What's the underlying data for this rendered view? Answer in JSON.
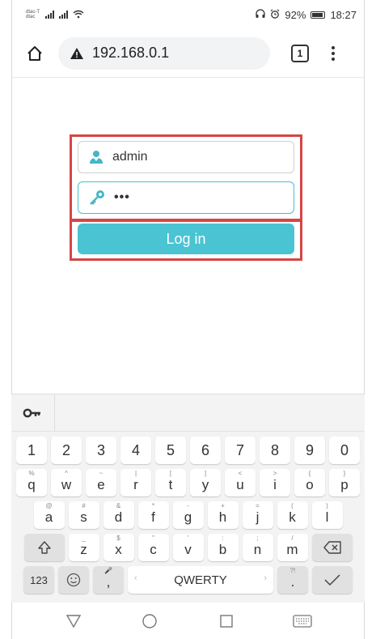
{
  "status_bar": {
    "carrier_top": "dtac-T",
    "carrier_bottom": "dtac",
    "battery_text": "92%",
    "time": "18:27"
  },
  "browser": {
    "url": "192.168.0.1",
    "tab_count": "1"
  },
  "login_form": {
    "username_value": "admin",
    "password_value": "•••",
    "login_label": "Log in",
    "accent_color": "#4ac3d3",
    "highlight_color": "#d64545"
  },
  "keyboard": {
    "number_row": [
      "1",
      "2",
      "3",
      "4",
      "5",
      "6",
      "7",
      "8",
      "9",
      "0"
    ],
    "row1": [
      {
        "hint": "%",
        "key": "q"
      },
      {
        "hint": "^",
        "key": "w"
      },
      {
        "hint": "~",
        "key": "e"
      },
      {
        "hint": "|",
        "key": "r"
      },
      {
        "hint": "[",
        "key": "t"
      },
      {
        "hint": "]",
        "key": "y"
      },
      {
        "hint": "<",
        "key": "u"
      },
      {
        "hint": ">",
        "key": "i"
      },
      {
        "hint": "{",
        "key": "o"
      },
      {
        "hint": "}",
        "key": "p"
      }
    ],
    "row2": [
      {
        "hint": "@",
        "key": "a"
      },
      {
        "hint": "#",
        "key": "s"
      },
      {
        "hint": "&",
        "key": "d"
      },
      {
        "hint": "*",
        "key": "f"
      },
      {
        "hint": "-",
        "key": "g"
      },
      {
        "hint": "+",
        "key": "h"
      },
      {
        "hint": "=",
        "key": "j"
      },
      {
        "hint": "(",
        "key": "k"
      },
      {
        "hint": ")",
        "key": "l"
      }
    ],
    "row3": [
      {
        "hint": "_",
        "key": "z"
      },
      {
        "hint": "$",
        "key": "x"
      },
      {
        "hint": "\"",
        "key": "c"
      },
      {
        "hint": "'",
        "key": "v"
      },
      {
        "hint": ":",
        "key": "b"
      },
      {
        "hint": ";",
        "key": "n"
      },
      {
        "hint": "/",
        "key": "m"
      }
    ],
    "symbols_label": "123",
    "comma_label": ",",
    "space_label": "QWERTY",
    "period_label": "."
  }
}
